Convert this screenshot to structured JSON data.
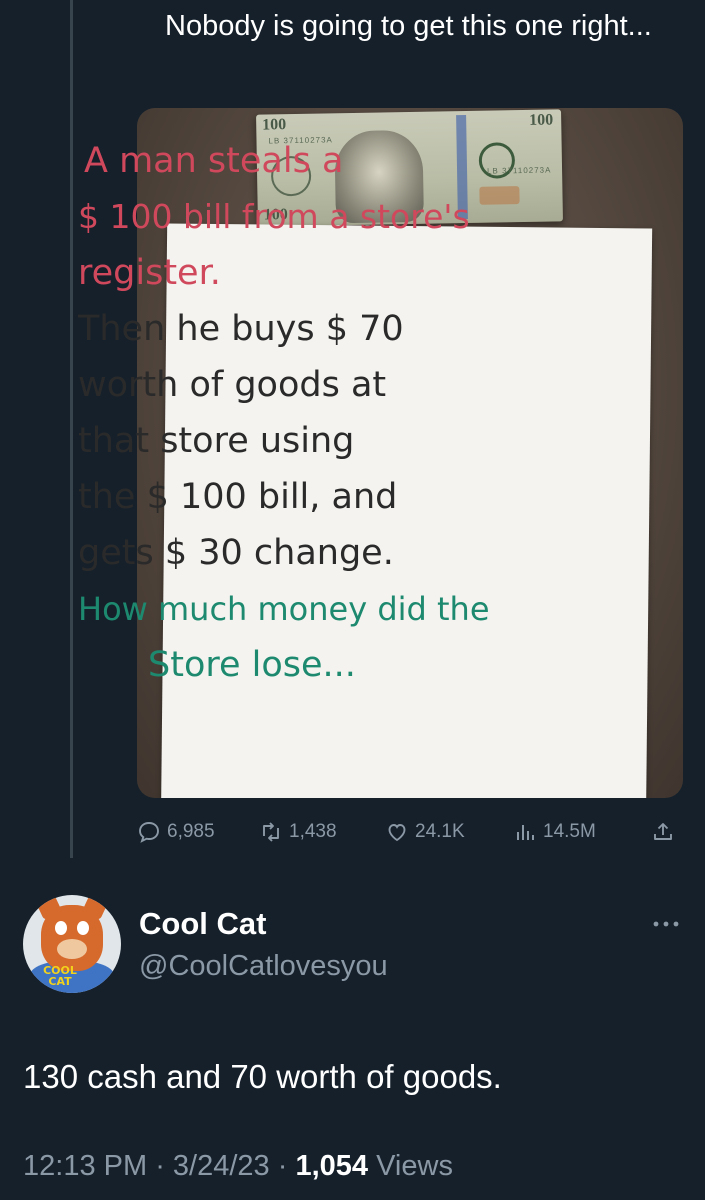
{
  "quoted_tweet": {
    "text": "Nobody is going to get this one right...",
    "image": {
      "bill_denomination": "100",
      "sign_lines": [
        {
          "text": "A man steals a",
          "color": "red"
        },
        {
          "text": "$ 100 bill from a store's",
          "color": "red"
        },
        {
          "text": "register.",
          "color": "red"
        },
        {
          "text": "Then he buys $ 70",
          "color": "dark"
        },
        {
          "text": "worth of goods at",
          "color": "dark"
        },
        {
          "text": "that store using",
          "color": "dark"
        },
        {
          "text": "the $ 100 bill, and",
          "color": "dark"
        },
        {
          "text": "gets $ 30 change.",
          "color": "dark"
        },
        {
          "text": "How much money did the",
          "color": "teal"
        },
        {
          "text": "Store lose...",
          "color": "teal"
        }
      ]
    },
    "actions": {
      "replies": "6,985",
      "retweets": "1,438",
      "likes": "24.1K",
      "views": "14.5M"
    }
  },
  "reply": {
    "avatar_text": "COOL CAT",
    "display_name": "Cool Cat",
    "handle": "@CoolCatlovesyou",
    "text": "130 cash and 70 worth of goods.",
    "time": "12:13 PM",
    "date": "3/24/23",
    "views_count": "1,054",
    "views_label": "Views"
  },
  "colors": {
    "background": "#15202b",
    "secondary_text": "#8b98a5",
    "sign_red": "#d0485c",
    "sign_teal": "#1d8a6f"
  },
  "icons": [
    "reply-icon",
    "retweet-icon",
    "like-icon",
    "views-icon",
    "share-icon",
    "more-icon"
  ]
}
